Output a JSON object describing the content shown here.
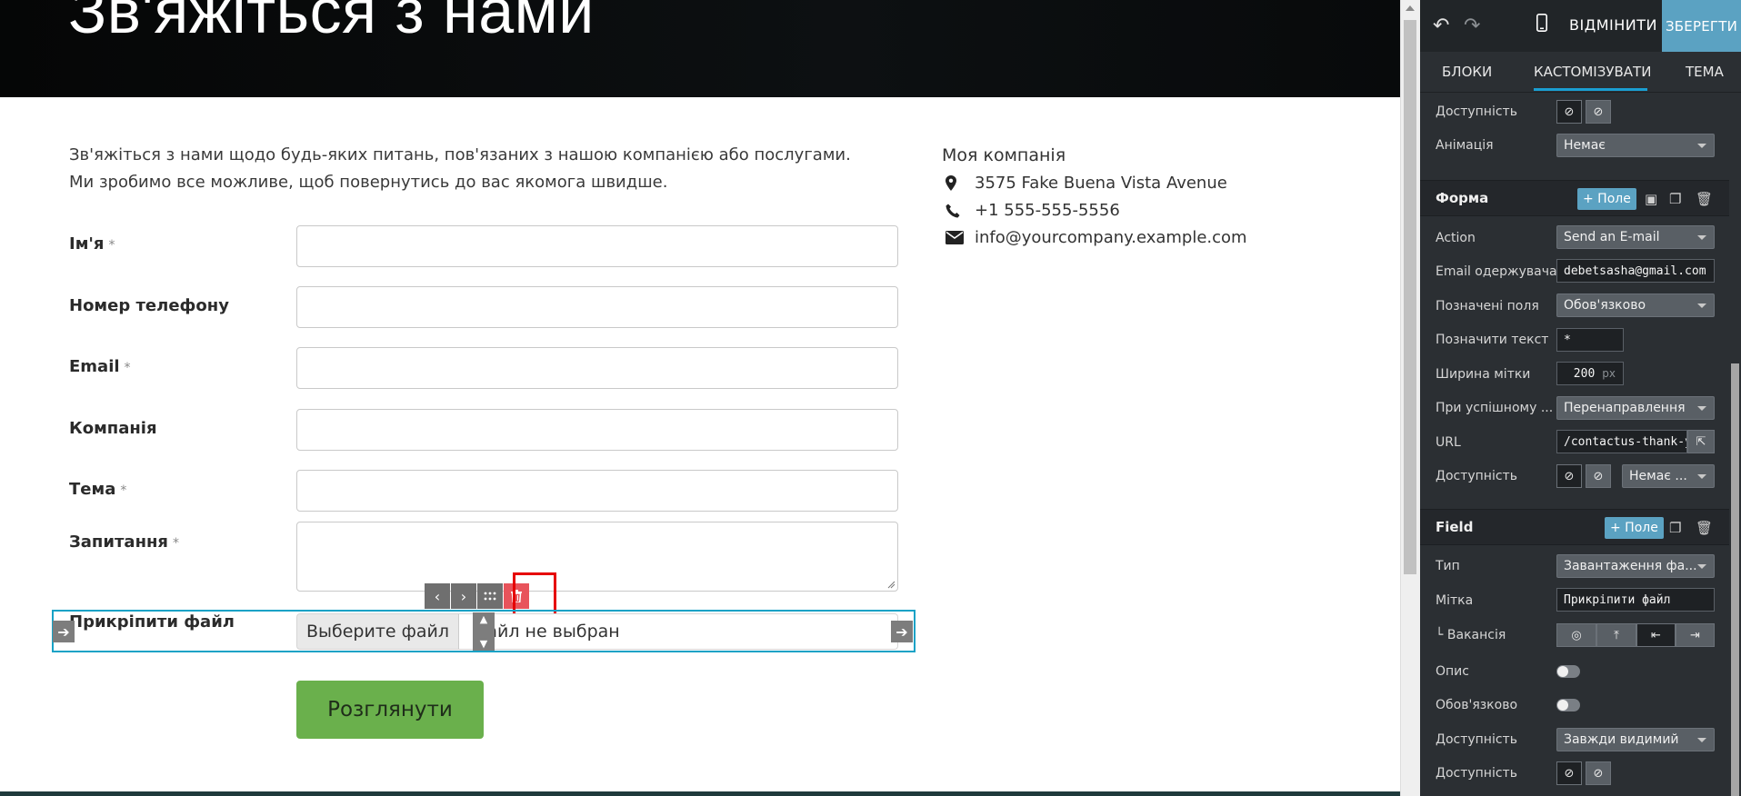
{
  "hero": {
    "title": "Зв'яжіться з нами"
  },
  "intro": {
    "line1": "Зв'яжіться з нами щодо будь-яких питань, пов'язаних з нашою компанією або послугами.",
    "line2": "Ми зробимо все можливе, щоб повернутись до вас якомога швидше."
  },
  "form": {
    "required_mark": "*",
    "fields": [
      {
        "label": "Ім'я",
        "required": true
      },
      {
        "label": "Номер телефону",
        "required": false
      },
      {
        "label": "Email",
        "required": true
      },
      {
        "label": "Компанія",
        "required": false
      },
      {
        "label": "Тема",
        "required": true
      },
      {
        "label": "Запитання",
        "required": true
      },
      {
        "label": "Прикріпити файл",
        "required": false
      }
    ],
    "file_button": "Выберите файл",
    "file_status": "Файл не выбран",
    "submit": "Розглянути"
  },
  "company": {
    "name": "Моя компанія",
    "address": "3575 Fake Buena Vista Avenue",
    "phone": "+1 555-555-5556",
    "email": "info@yourcompany.example.com"
  },
  "editor": {
    "discard": "ВІДМІНИТИ",
    "save": "ЗБЕРЕГТИ",
    "tabs": [
      "БЛОКИ",
      "КАСТОМІЗУВАТИ",
      "ТЕМА"
    ],
    "top_section": {
      "visibility_label": "Доступність",
      "animation_label": "Анімація",
      "animation_value": "Немає"
    },
    "form_section": {
      "title": "Форма",
      "add_field": "+ Поле",
      "action_label": "Action",
      "action_value": "Send an E-mail",
      "recipient_label": "Email одержувача",
      "recipient_value": "debetsasha@gmail.com",
      "marked_label": "Позначені поля",
      "marked_value": "Обов'язково",
      "mark_text_label": "Позначити текст",
      "mark_text_value": "*",
      "label_width_label": "Ширина мітки",
      "label_width_value": "200",
      "label_width_unit": "px",
      "on_success_label": "При успішному ...",
      "on_success_value": "Перенаправлення",
      "url_label": "URL",
      "url_value": "/contactus-thank-you",
      "visibility_label": "Доступність",
      "visibility_value": "Немає ..."
    },
    "field_section": {
      "title": "Field",
      "add_field": "+ Поле",
      "type_label": "Тип",
      "type_value": "Завантаження фа...",
      "label_label": "Мітка",
      "label_value": "Прикріпити файл",
      "position_label": "└ Вакансія",
      "description_label": "Опис",
      "required_label": "Обов'язково",
      "visibility_label": "Доступність",
      "visibility_value": "Завжди видимий",
      "visibility2_label": "Доступність"
    }
  },
  "colors": {
    "accent": "#5ba2c2",
    "panel_bg": "#2b2f33",
    "submit_bg": "#6ab04c",
    "selection_border": "#17a2c6",
    "delete_highlight": "#e60000"
  }
}
